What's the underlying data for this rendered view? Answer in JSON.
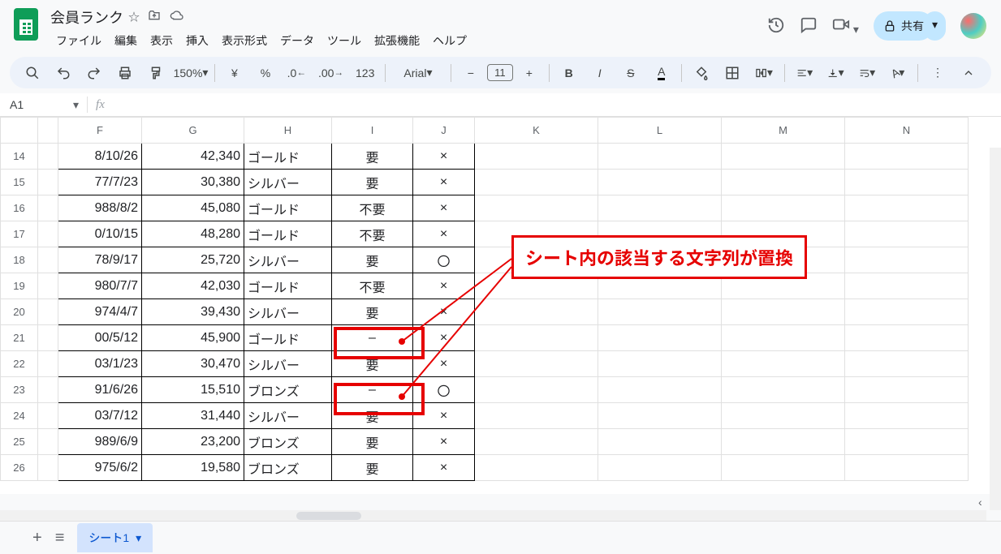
{
  "doc_title": "会員ランク",
  "menu": {
    "file": "ファイル",
    "edit": "編集",
    "view": "表示",
    "insert": "挿入",
    "format": "表示形式",
    "data": "データ",
    "tools": "ツール",
    "extensions": "拡張機能",
    "help": "ヘルプ"
  },
  "toolbar": {
    "zoom": "150%",
    "font": "Arial",
    "font_size": "11"
  },
  "share": {
    "label": "共有"
  },
  "name_box": "A1",
  "fx_label": "fx",
  "columns": [
    "F",
    "G",
    "H",
    "I",
    "J",
    "K",
    "L",
    "M",
    "N"
  ],
  "rows": [
    {
      "n": "14",
      "f": "8/10/26",
      "g": "42,340",
      "h": "ゴールド",
      "i": "要",
      "j": "×"
    },
    {
      "n": "15",
      "f": "77/7/23",
      "g": "30,380",
      "h": "シルバー",
      "i": "要",
      "j": "×"
    },
    {
      "n": "16",
      "f": "988/8/2",
      "g": "45,080",
      "h": "ゴールド",
      "i": "不要",
      "j": "×"
    },
    {
      "n": "17",
      "f": "0/10/15",
      "g": "48,280",
      "h": "ゴールド",
      "i": "不要",
      "j": "×"
    },
    {
      "n": "18",
      "f": "78/9/17",
      "g": "25,720",
      "h": "シルバー",
      "i": "要",
      "j": "〇"
    },
    {
      "n": "19",
      "f": "980/7/7",
      "g": "42,030",
      "h": "ゴールド",
      "i": "不要",
      "j": "×"
    },
    {
      "n": "20",
      "f": "974/4/7",
      "g": "39,430",
      "h": "シルバー",
      "i": "要",
      "j": "×"
    },
    {
      "n": "21",
      "f": "00/5/12",
      "g": "45,900",
      "h": "ゴールド",
      "i": "–",
      "j": "×"
    },
    {
      "n": "22",
      "f": "03/1/23",
      "g": "30,470",
      "h": "シルバー",
      "i": "要",
      "j": "×"
    },
    {
      "n": "23",
      "f": "91/6/26",
      "g": "15,510",
      "h": "ブロンズ",
      "i": "–",
      "j": "〇"
    },
    {
      "n": "24",
      "f": "03/7/12",
      "g": "31,440",
      "h": "シルバー",
      "i": "要",
      "j": "×"
    },
    {
      "n": "25",
      "f": "989/6/9",
      "g": "23,200",
      "h": "ブロンズ",
      "i": "要",
      "j": "×"
    },
    {
      "n": "26",
      "f": "975/6/2",
      "g": "19,580",
      "h": "ブロンズ",
      "i": "要",
      "j": "×"
    }
  ],
  "callout": "シート内の該当する文字列が置換",
  "sheet_tab": "シート1"
}
